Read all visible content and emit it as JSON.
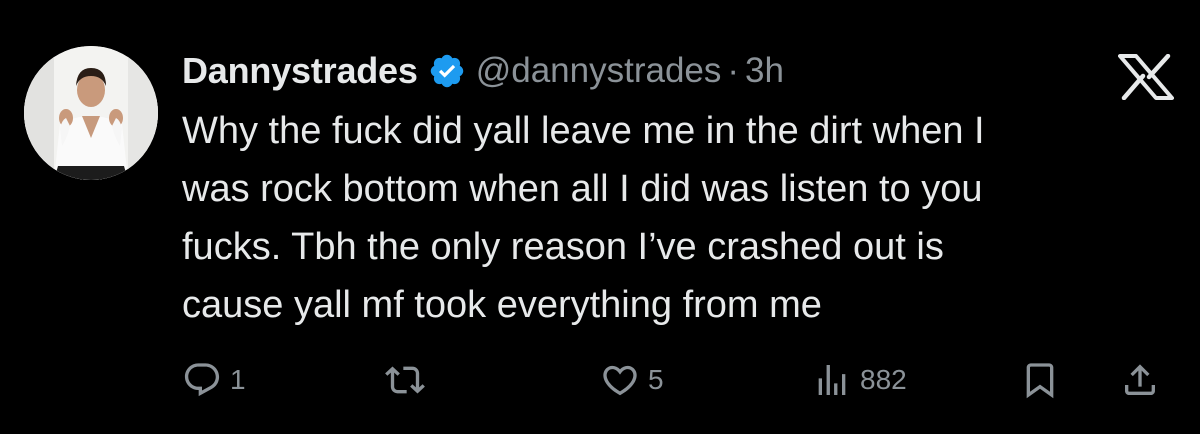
{
  "tweet": {
    "display_name": "Dannystrades",
    "handle": "@dannystrades",
    "separator": "·",
    "time": "3h",
    "text_lines": [
      "Why the fuck did yall leave me in the dirt when I",
      "was rock bottom when all I did was listen to you",
      "fucks. Tbh the only reason I’ve crashed out is",
      "cause yall mf took everything from me"
    ]
  },
  "actions": {
    "reply_count": "1",
    "repost_count": "",
    "like_count": "5",
    "views_count": "882"
  },
  "icons": {
    "verified": "verified-badge-icon",
    "logo": "x-logo-icon",
    "reply": "reply-icon",
    "repost": "repost-icon",
    "like": "heart-icon",
    "views": "views-icon",
    "bookmark": "bookmark-icon",
    "share": "share-icon"
  },
  "colors": {
    "background": "#000000",
    "text": "#e7e9ea",
    "muted": "#8b9298",
    "verified": "#1d9bf0"
  }
}
